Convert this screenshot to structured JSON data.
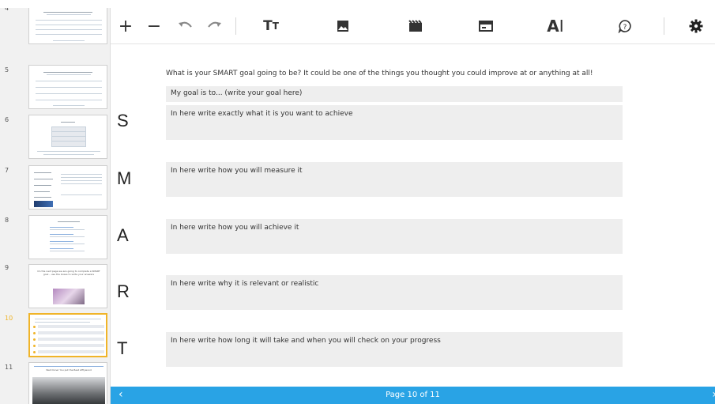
{
  "sidebar": {
    "slides": [
      {
        "number": "4",
        "active": false
      },
      {
        "number": "5",
        "active": false
      },
      {
        "number": "6",
        "active": false
      },
      {
        "number": "7",
        "active": false
      },
      {
        "number": "8",
        "active": false
      },
      {
        "number": "9",
        "active": false
      },
      {
        "number": "10",
        "active": true
      },
      {
        "number": "11",
        "active": false
      }
    ]
  },
  "toolbar": {
    "tools": [
      {
        "name": "add-icon",
        "glyph": "+"
      },
      {
        "name": "remove-icon",
        "glyph": "−"
      },
      {
        "name": "undo-icon",
        "glyph": "↶"
      },
      {
        "name": "redo-icon",
        "glyph": "↷"
      },
      {
        "name": "text-size-icon",
        "glyph": "Tт"
      },
      {
        "name": "image-icon",
        "glyph": "image"
      },
      {
        "name": "video-icon",
        "glyph": "video"
      },
      {
        "name": "layout-icon",
        "glyph": "layout"
      },
      {
        "name": "text-cursor-icon",
        "glyph": "AI"
      },
      {
        "name": "help-icon",
        "glyph": "?"
      },
      {
        "name": "settings-icon",
        "glyph": "gear"
      }
    ]
  },
  "page": {
    "question": "What is your SMART goal going to be? It could be one of the things you thought you could improve at or anything at all!",
    "goal_field": "My goal is to... (write your goal here)",
    "rows": [
      {
        "letter": "S",
        "placeholder": "In here write exactly what it is you want to achieve"
      },
      {
        "letter": "M",
        "placeholder": "In here write how you will measure it"
      },
      {
        "letter": "A",
        "placeholder": "In here write how you will achieve it"
      },
      {
        "letter": "R",
        "placeholder": "In here write why it is relevant or realistic"
      },
      {
        "letter": "T",
        "placeholder": "In here write how long it will take and when you will check on your progress"
      }
    ]
  },
  "footer": {
    "prev": "‹",
    "page_label": "Page 10 of 11",
    "next": "›"
  },
  "colors": {
    "accent": "#29a3e5",
    "active_slide": "#f0b429",
    "field_bg": "#eeeeee"
  },
  "thumb_text": {
    "slide9_caption": "On the next page we are going to complete a SMART goal – use the boxes to write your answers",
    "slide11_caption": "Well Done! You put the Best Afflywood"
  }
}
